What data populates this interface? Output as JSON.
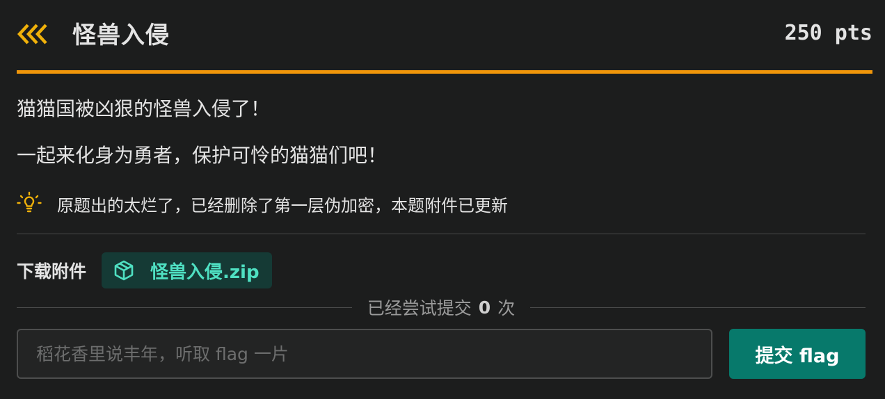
{
  "challenge": {
    "title": "怪兽入侵",
    "points": "250 pts",
    "description": [
      "猫猫国被凶狠的怪兽入侵了！",
      "一起来化身为勇者，保护可怜的猫猫们吧！"
    ],
    "hint": "原题出的太烂了，已经删除了第一层伪加密，本题附件已更新"
  },
  "attachment": {
    "label": "下载附件",
    "filename": "怪兽入侵.zip"
  },
  "attempts": {
    "prefix": "已经尝试提交",
    "count": "0",
    "suffix": "次"
  },
  "submission": {
    "placeholder": "稻花香里说丰年，听取 flag 一片",
    "value": "",
    "button_label": "提交 flag"
  },
  "colors": {
    "accent": "#f0960a",
    "file_text": "#4fe0c2",
    "submit_bg": "#07796b",
    "background": "#1c1d1d"
  },
  "icons": {
    "back": "triple-chevron-left-icon",
    "hint": "lightbulb-icon",
    "file": "package-cube-icon"
  }
}
